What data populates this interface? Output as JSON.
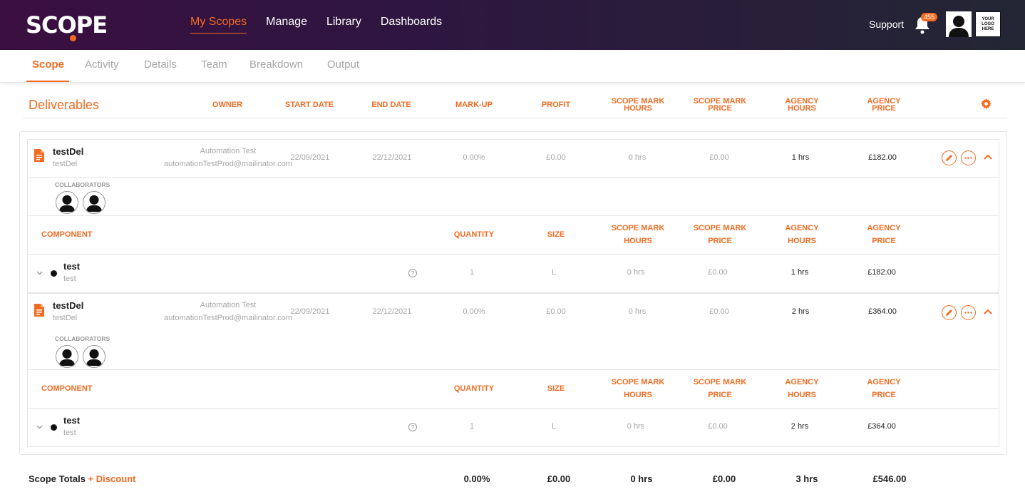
{
  "app": {
    "logo": "SCOPE",
    "nav": [
      "My Scopes",
      "Manage",
      "Library",
      "Dashboards"
    ],
    "support": "Support",
    "notifications": "455",
    "company_logo": [
      "YOUR",
      "LOGO",
      "HERE"
    ]
  },
  "tabs": [
    "Scope",
    "Activity",
    "Details",
    "Team",
    "Breakdown",
    "Output"
  ],
  "header": {
    "title": "Deliverables",
    "owner": "OWNER",
    "start_date": "START DATE",
    "end_date": "END DATE",
    "markup": "MARK-UP",
    "profit": "PROFIT",
    "smh": [
      "SCOPE MARK",
      "HOURS"
    ],
    "smp": [
      "SCOPE MARK",
      "PRICE"
    ],
    "ah": [
      "AGENCY",
      "HOURS"
    ],
    "ap": [
      "AGENCY",
      "PRICE"
    ]
  },
  "component_header": {
    "component": "COMPONENT",
    "quantity": "QUANTITY",
    "size": "SIZE",
    "smh": [
      "SCOPE MARK",
      "HOURS"
    ],
    "smp": [
      "SCOPE MARK",
      "PRICE"
    ],
    "ah": [
      "AGENCY",
      "HOURS"
    ],
    "ap": [
      "AGENCY",
      "PRICE"
    ]
  },
  "collaborators_label": "COLLABORATORS",
  "deliverables": [
    {
      "name": "testDel",
      "subtitle": "testDel",
      "owner": "Automation Test",
      "owner_email": "automationTestProd@mailinator.com",
      "start": "22/09/2021",
      "end": "22/12/2021",
      "markup": "0.00%",
      "profit": "£0.00",
      "smh": "0 hrs",
      "smp": "£0.00",
      "ah": "1 hrs",
      "ap": "£182.00",
      "component": {
        "name": "test",
        "subtitle": "test",
        "qty": "1",
        "size": "L",
        "smh": "0 hrs",
        "smp": "£0.00",
        "ah": "1 hrs",
        "ap": "£182.00"
      }
    },
    {
      "name": "testDel",
      "subtitle": "testDel",
      "owner": "Automation Test",
      "owner_email": "automationTestProd@mailinator.com",
      "start": "22/09/2021",
      "end": "22/12/2021",
      "markup": "0.00%",
      "profit": "£0.00",
      "smh": "0 hrs",
      "smp": "£0.00",
      "ah": "2 hrs",
      "ap": "£364.00",
      "component": {
        "name": "test",
        "subtitle": "test",
        "qty": "1",
        "size": "L",
        "smh": "0 hrs",
        "smp": "£0.00",
        "ah": "2 hrs",
        "ap": "£364.00"
      }
    }
  ],
  "totals": {
    "label": "Scope Totals",
    "discount": "+ Discount",
    "markup": "0.00%",
    "profit": "£0.00",
    "smh": "0 hrs",
    "smp": "£0.00",
    "ah": "3 hrs",
    "ap": "£546.00"
  },
  "colors": {
    "accent": "#f26b21",
    "topbar": "#2e1640"
  }
}
